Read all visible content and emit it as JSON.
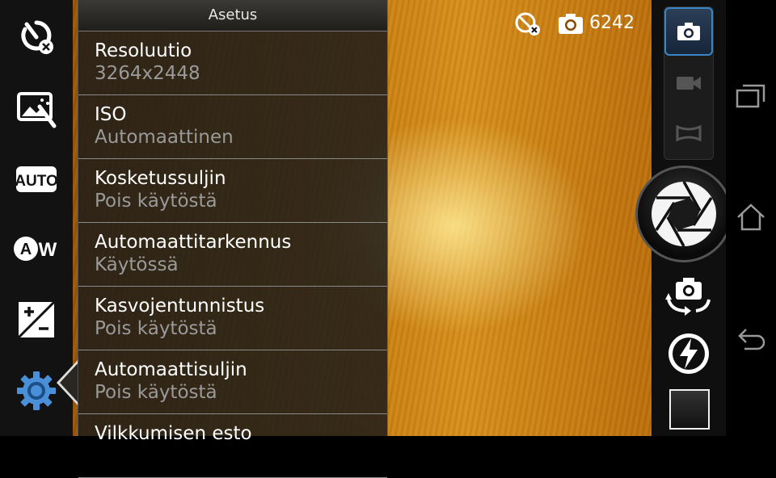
{
  "settings_panel": {
    "title": "Asetus",
    "items": [
      {
        "label": "Resoluutio",
        "value": "3264x2448"
      },
      {
        "label": "ISO",
        "value": "Automaattinen"
      },
      {
        "label": "Kosketussuljin",
        "value": "Pois käytöstä"
      },
      {
        "label": "Automaattitarkennus",
        "value": "Käytössä"
      },
      {
        "label": "Kasvojentunnistus",
        "value": "Pois käytöstä"
      },
      {
        "label": "Automaattisuljin",
        "value": "Pois käytöstä"
      },
      {
        "label": "Vilkkumisen esto",
        "value": ""
      }
    ]
  },
  "status_bar": {
    "remaining_shots": "6242"
  },
  "left_toolbar": {
    "items": [
      "self-timer-off-icon",
      "scene-mode-icon",
      "auto-mode-icon",
      "white-balance-icon",
      "exposure-icon",
      "settings-gear-icon"
    ]
  },
  "colors": {
    "accent_blue": "#3a86c4",
    "panel_bg": "#1e1c18",
    "value_gray": "#9a9a9a"
  }
}
